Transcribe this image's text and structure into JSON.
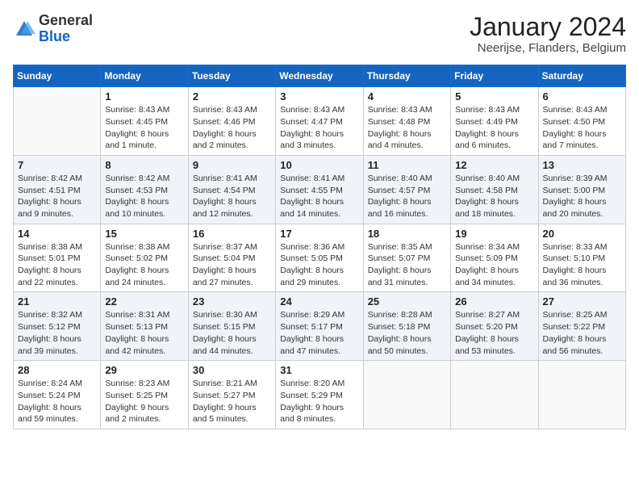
{
  "header": {
    "logo_general": "General",
    "logo_blue": "Blue",
    "title": "January 2024",
    "subtitle": "Neerijse, Flanders, Belgium"
  },
  "calendar": {
    "days_of_week": [
      "Sunday",
      "Monday",
      "Tuesday",
      "Wednesday",
      "Thursday",
      "Friday",
      "Saturday"
    ],
    "weeks": [
      [
        {
          "day": "",
          "empty": true
        },
        {
          "day": "1",
          "sunrise": "8:43 AM",
          "sunset": "4:45 PM",
          "daylight": "8 hours and 1 minute."
        },
        {
          "day": "2",
          "sunrise": "8:43 AM",
          "sunset": "4:46 PM",
          "daylight": "8 hours and 2 minutes."
        },
        {
          "day": "3",
          "sunrise": "8:43 AM",
          "sunset": "4:47 PM",
          "daylight": "8 hours and 3 minutes."
        },
        {
          "day": "4",
          "sunrise": "8:43 AM",
          "sunset": "4:48 PM",
          "daylight": "8 hours and 4 minutes."
        },
        {
          "day": "5",
          "sunrise": "8:43 AM",
          "sunset": "4:49 PM",
          "daylight": "8 hours and 6 minutes."
        },
        {
          "day": "6",
          "sunrise": "8:43 AM",
          "sunset": "4:50 PM",
          "daylight": "8 hours and 7 minutes."
        }
      ],
      [
        {
          "day": "7",
          "sunrise": "8:42 AM",
          "sunset": "4:51 PM",
          "daylight": "8 hours and 9 minutes."
        },
        {
          "day": "8",
          "sunrise": "8:42 AM",
          "sunset": "4:53 PM",
          "daylight": "8 hours and 10 minutes."
        },
        {
          "day": "9",
          "sunrise": "8:41 AM",
          "sunset": "4:54 PM",
          "daylight": "8 hours and 12 minutes."
        },
        {
          "day": "10",
          "sunrise": "8:41 AM",
          "sunset": "4:55 PM",
          "daylight": "8 hours and 14 minutes."
        },
        {
          "day": "11",
          "sunrise": "8:40 AM",
          "sunset": "4:57 PM",
          "daylight": "8 hours and 16 minutes."
        },
        {
          "day": "12",
          "sunrise": "8:40 AM",
          "sunset": "4:58 PM",
          "daylight": "8 hours and 18 minutes."
        },
        {
          "day": "13",
          "sunrise": "8:39 AM",
          "sunset": "5:00 PM",
          "daylight": "8 hours and 20 minutes."
        }
      ],
      [
        {
          "day": "14",
          "sunrise": "8:38 AM",
          "sunset": "5:01 PM",
          "daylight": "8 hours and 22 minutes."
        },
        {
          "day": "15",
          "sunrise": "8:38 AM",
          "sunset": "5:02 PM",
          "daylight": "8 hours and 24 minutes."
        },
        {
          "day": "16",
          "sunrise": "8:37 AM",
          "sunset": "5:04 PM",
          "daylight": "8 hours and 27 minutes."
        },
        {
          "day": "17",
          "sunrise": "8:36 AM",
          "sunset": "5:05 PM",
          "daylight": "8 hours and 29 minutes."
        },
        {
          "day": "18",
          "sunrise": "8:35 AM",
          "sunset": "5:07 PM",
          "daylight": "8 hours and 31 minutes."
        },
        {
          "day": "19",
          "sunrise": "8:34 AM",
          "sunset": "5:09 PM",
          "daylight": "8 hours and 34 minutes."
        },
        {
          "day": "20",
          "sunrise": "8:33 AM",
          "sunset": "5:10 PM",
          "daylight": "8 hours and 36 minutes."
        }
      ],
      [
        {
          "day": "21",
          "sunrise": "8:32 AM",
          "sunset": "5:12 PM",
          "daylight": "8 hours and 39 minutes."
        },
        {
          "day": "22",
          "sunrise": "8:31 AM",
          "sunset": "5:13 PM",
          "daylight": "8 hours and 42 minutes."
        },
        {
          "day": "23",
          "sunrise": "8:30 AM",
          "sunset": "5:15 PM",
          "daylight": "8 hours and 44 minutes."
        },
        {
          "day": "24",
          "sunrise": "8:29 AM",
          "sunset": "5:17 PM",
          "daylight": "8 hours and 47 minutes."
        },
        {
          "day": "25",
          "sunrise": "8:28 AM",
          "sunset": "5:18 PM",
          "daylight": "8 hours and 50 minutes."
        },
        {
          "day": "26",
          "sunrise": "8:27 AM",
          "sunset": "5:20 PM",
          "daylight": "8 hours and 53 minutes."
        },
        {
          "day": "27",
          "sunrise": "8:25 AM",
          "sunset": "5:22 PM",
          "daylight": "8 hours and 56 minutes."
        }
      ],
      [
        {
          "day": "28",
          "sunrise": "8:24 AM",
          "sunset": "5:24 PM",
          "daylight": "8 hours and 59 minutes."
        },
        {
          "day": "29",
          "sunrise": "8:23 AM",
          "sunset": "5:25 PM",
          "daylight": "9 hours and 2 minutes."
        },
        {
          "day": "30",
          "sunrise": "8:21 AM",
          "sunset": "5:27 PM",
          "daylight": "9 hours and 5 minutes."
        },
        {
          "day": "31",
          "sunrise": "8:20 AM",
          "sunset": "5:29 PM",
          "daylight": "9 hours and 8 minutes."
        },
        {
          "day": "",
          "empty": true
        },
        {
          "day": "",
          "empty": true
        },
        {
          "day": "",
          "empty": true
        }
      ]
    ]
  }
}
